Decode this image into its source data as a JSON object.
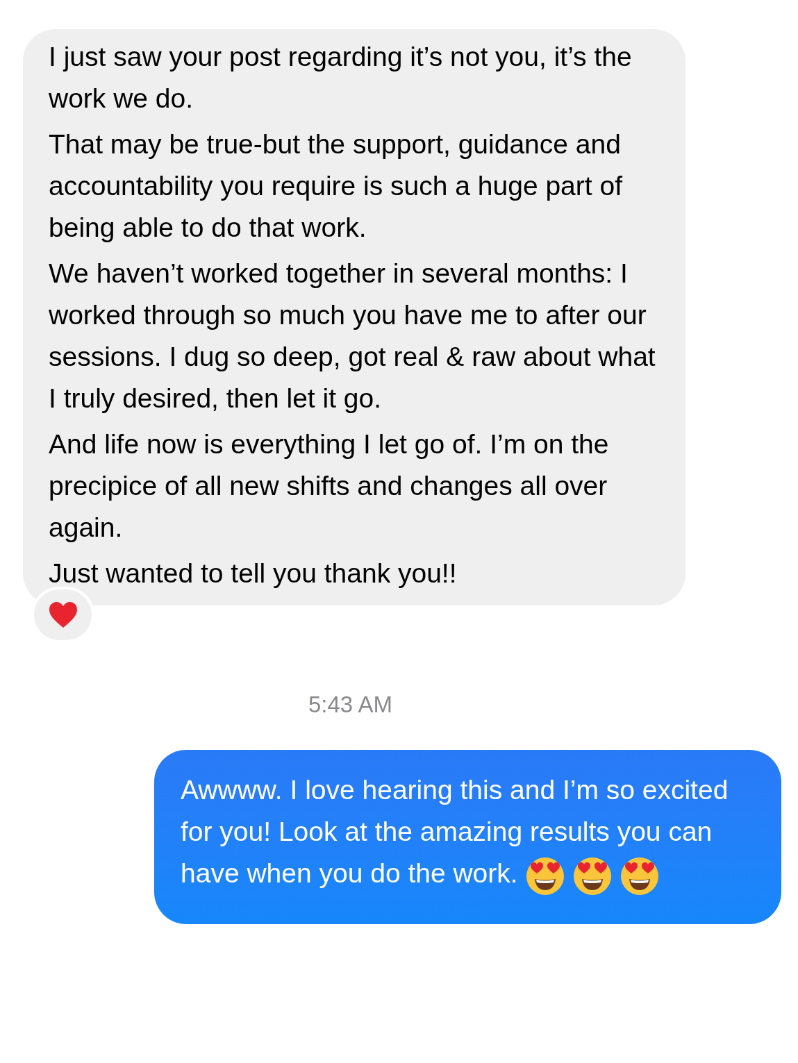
{
  "incoming_message": {
    "paragraphs": [
      "I just saw your post regarding it’s not you, it’s the work we do.",
      "That may be true-but the support, guidance and accountability you require is such a huge part of being able to do that work.",
      "We haven’t worked together in several months: I worked through so much you have me to after our sessions. I dug so deep, got real & raw about what I truly desired, then let it go.",
      "And life now is everything I let go of. I’m on the precipice of all new shifts and changes all over again.",
      "Just wanted to tell you thank you!!"
    ],
    "reaction": {
      "kind": "heart"
    }
  },
  "timestamp": "5:43 AM",
  "outgoing_message": {
    "text": "Awwww. I love hearing this and I’m so excited for you!  Look at the amazing results you can have when you do the work.",
    "emojis": [
      {
        "kind": "heart-eyes"
      },
      {
        "kind": "heart-eyes"
      },
      {
        "kind": "heart-eyes"
      }
    ]
  }
}
